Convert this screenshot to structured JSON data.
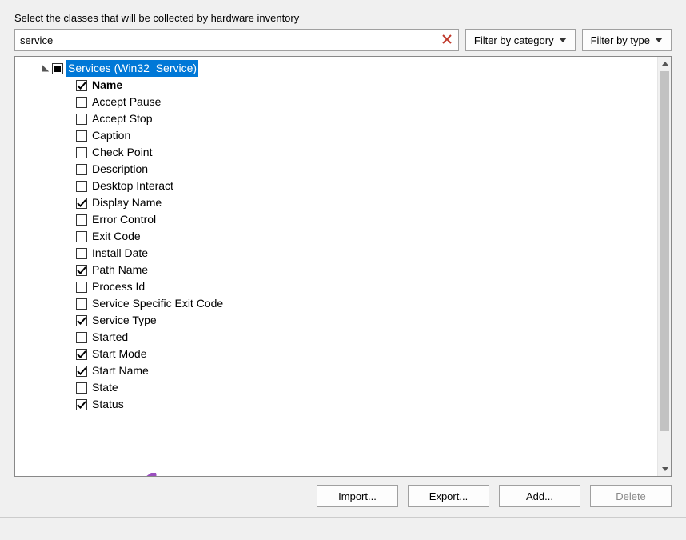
{
  "instruction": "Select the classes that will be collected by hardware inventory",
  "search": {
    "value": "service",
    "placeholder": ""
  },
  "filters": {
    "category": "Filter by category",
    "type": "Filter by type"
  },
  "tree": {
    "root": {
      "label": "Services (Win32_Service)",
      "state": "indeterminate",
      "expanded": true,
      "selected": true
    },
    "children": [
      {
        "label": "Name",
        "checked": true,
        "bold": true
      },
      {
        "label": "Accept Pause",
        "checked": false
      },
      {
        "label": "Accept Stop",
        "checked": false
      },
      {
        "label": "Caption",
        "checked": false
      },
      {
        "label": "Check Point",
        "checked": false
      },
      {
        "label": "Description",
        "checked": false
      },
      {
        "label": "Desktop Interact",
        "checked": false
      },
      {
        "label": "Display Name",
        "checked": true
      },
      {
        "label": "Error Control",
        "checked": false
      },
      {
        "label": "Exit Code",
        "checked": false
      },
      {
        "label": "Install Date",
        "checked": false
      },
      {
        "label": "Path Name",
        "checked": true
      },
      {
        "label": "Process Id",
        "checked": false
      },
      {
        "label": "Service Specific Exit Code",
        "checked": false
      },
      {
        "label": "Service Type",
        "checked": true
      },
      {
        "label": "Started",
        "checked": false
      },
      {
        "label": "Start Mode",
        "checked": true
      },
      {
        "label": "Start Name",
        "checked": true
      },
      {
        "label": "State",
        "checked": false
      },
      {
        "label": "Status",
        "checked": true
      }
    ]
  },
  "buttons": {
    "import": "Import...",
    "export": "Export...",
    "add": "Add...",
    "delete": "Delete"
  },
  "annotation": {
    "type": "arrow",
    "color": "#9b4fbf",
    "target": "State"
  }
}
